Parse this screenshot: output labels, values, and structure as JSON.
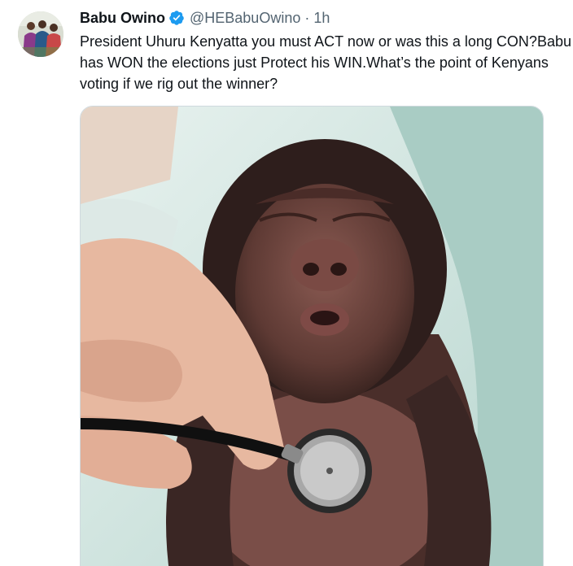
{
  "tweet": {
    "author_name": "Babu Owino",
    "handle": "@HEBabuOwino",
    "separator": "·",
    "time": "1h",
    "text_lines": [
      "President Uhuru Kenyatta you must ACT now or was this a long CON?Babu",
      "has WON the elections just Protect his WIN.What’s the point of Kenyans",
      "voting if we rig out the winner?"
    ]
  },
  "icons": {
    "verified": "verified-badge-icon",
    "avatar": "profile-photo",
    "media": "photo-baby-gorilla-stethoscope"
  },
  "colors": {
    "verified_blue": "#1d9bf0",
    "text": "#0f1419",
    "secondary": "#536471",
    "border": "#cfd9de"
  }
}
